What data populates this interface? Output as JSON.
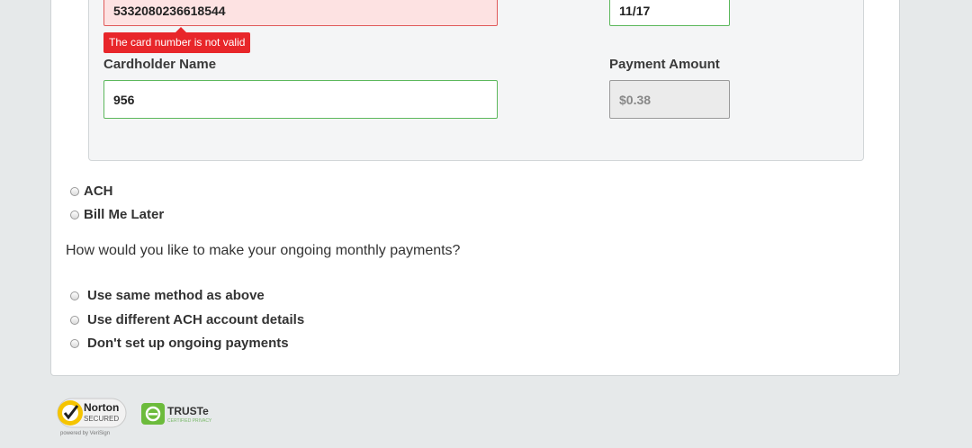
{
  "card_form": {
    "card_number_value": "5332080236618544",
    "card_number_error": "The card number is not valid",
    "expiry_value": "11/17",
    "cardholder_label": "Cardholder Name",
    "cardholder_value": "956",
    "payment_amount_label": "Payment Amount",
    "payment_amount_value": "$0.38"
  },
  "payment_methods": [
    {
      "label": "ACH"
    },
    {
      "label": "Bill Me Later"
    }
  ],
  "ongoing": {
    "question": "How would you like to make your ongoing monthly payments?",
    "options": [
      {
        "label": "Use same method as above"
      },
      {
        "label": "Use different ACH account details"
      },
      {
        "label": "Don't set up ongoing payments"
      }
    ]
  },
  "badges": {
    "norton_line1": "Norton",
    "norton_line2": "SECURED",
    "norton_powered": "powered by VeriSign",
    "truste_title": "TRUSTe",
    "truste_sub": "CERTIFIED PRIVACY"
  },
  "colors": {
    "error_red": "#e8262a",
    "valid_green": "#5cb85c",
    "norton_yellow": "#f5c400",
    "truste_green": "#6cbb3c"
  }
}
